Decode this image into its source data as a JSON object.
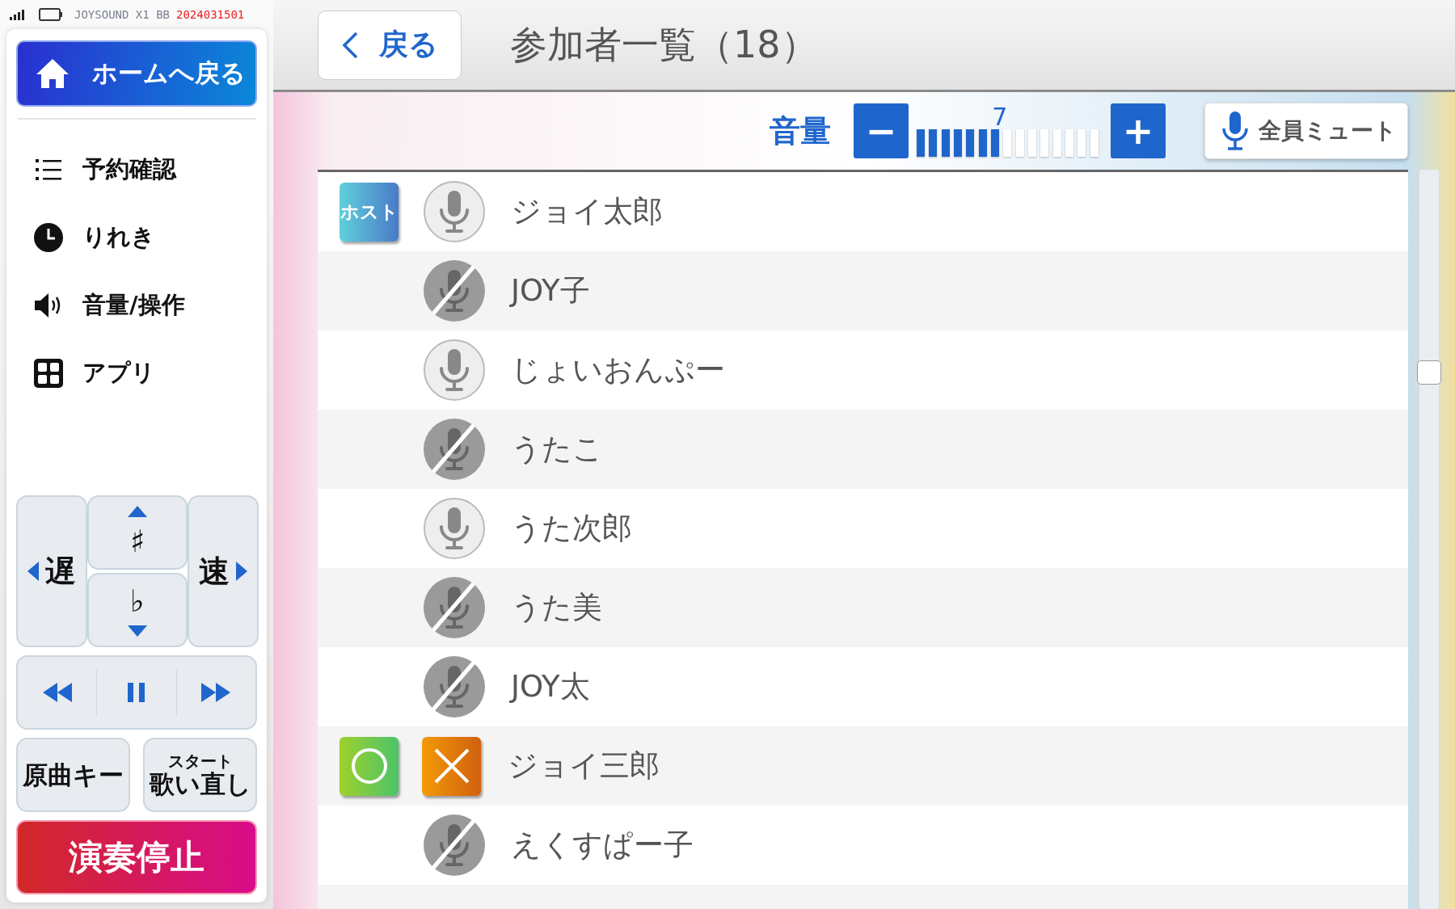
{
  "status_bar": {
    "device": "JOYSOUND X1 BB",
    "serial": "2024031501"
  },
  "sidebar": {
    "home_button": "ホームへ戻る",
    "items": [
      {
        "label": "予約確認"
      },
      {
        "label": "りれき"
      },
      {
        "label": "音量/操作"
      },
      {
        "label": "アプリ"
      }
    ],
    "controls": {
      "slower": "遅",
      "sharp": "♯",
      "flat": "♭",
      "faster": "速",
      "original_key": "原曲キー",
      "restart_caption": "スタート",
      "restart": "歌い直し",
      "stop": "演奏停止"
    }
  },
  "header": {
    "back": "戻る",
    "title": "参加者一覧（18）"
  },
  "volume": {
    "label": "音量",
    "minus": "−",
    "plus": "+",
    "reading": "7",
    "level": 0.4667,
    "mute_all": "全員ミュート"
  },
  "participants": [
    {
      "name": "ジョイ太郎",
      "kind": "member",
      "badge": "ホスト",
      "muted": false
    },
    {
      "name": "JOY子",
      "kind": "member",
      "muted": true
    },
    {
      "name": "じょいおんぷー",
      "kind": "member",
      "muted": false
    },
    {
      "name": "うたこ",
      "kind": "member",
      "muted": true
    },
    {
      "name": "うた次郎",
      "kind": "member",
      "muted": false
    },
    {
      "name": "うた美",
      "kind": "member",
      "muted": true
    },
    {
      "name": "JOY太",
      "kind": "member",
      "muted": true
    },
    {
      "name": "ジョイ三郎",
      "kind": "request"
    },
    {
      "name": "えくすぱー子",
      "kind": "member",
      "muted": true
    }
  ]
}
